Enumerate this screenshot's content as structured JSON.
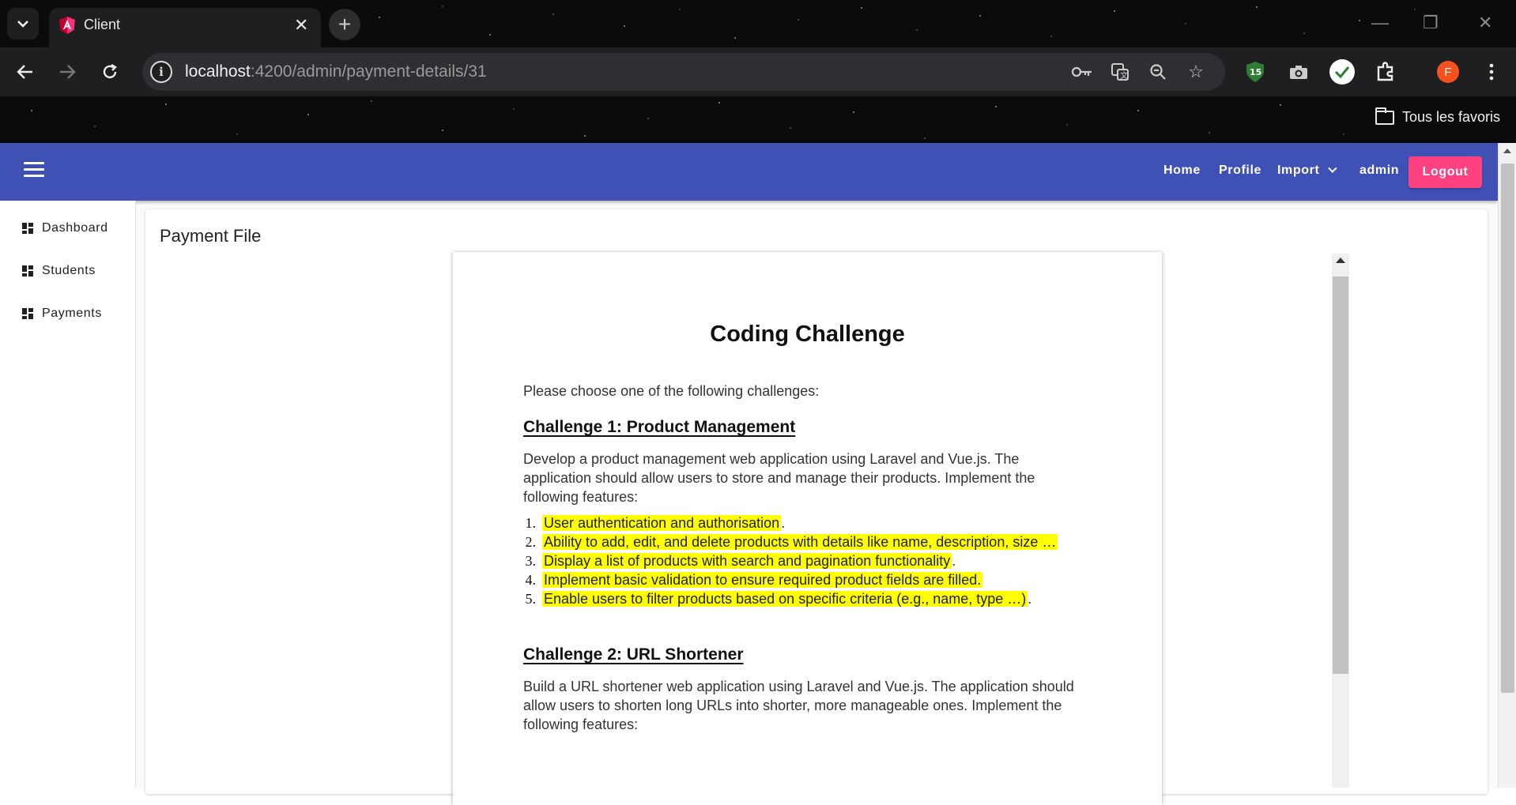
{
  "browser": {
    "tab_title": "Client",
    "url_host": "localhost",
    "url_path": ":4200/admin/payment-details/31",
    "bookmarks_label": "Tous les favoris",
    "profile_initial": "F",
    "extension_badge": "15"
  },
  "appbar": {
    "nav": {
      "home": "Home",
      "profile": "Profile",
      "import": "Import",
      "user": "admin",
      "logout": "Logout"
    },
    "color": "#3f51b5",
    "logout_color": "#ff4081"
  },
  "sidebar": {
    "items": [
      {
        "label": "Dashboard"
      },
      {
        "label": "Students"
      },
      {
        "label": "Payments"
      }
    ]
  },
  "main": {
    "title": "Payment File"
  },
  "document": {
    "title": "Coding Challenge",
    "intro": "Please choose one of the following challenges:",
    "challenge1": {
      "heading": "Challenge 1: Product Management",
      "desc_lines": [
        "Develop a product management web application using Laravel and Vue.js. The",
        "application should allow users to store and manage their products. Implement the",
        "following features:"
      ],
      "features": [
        {
          "num": "1.",
          "text": "User authentication and authorisation",
          "after": "."
        },
        {
          "num": "2.",
          "text": "Ability to add, edit, and delete products with details like name, description, size …",
          "after": ""
        },
        {
          "num": "3.",
          "text": "Display a list of products with search and pagination functionality",
          "after": "."
        },
        {
          "num": "4.",
          "text": "Implement basic validation to ensure required product fields are filled.",
          "after": ""
        },
        {
          "num": "5.",
          "text": "Enable users to filter products based on specific criteria (e.g., name, type …)",
          "after": "."
        }
      ]
    },
    "challenge2": {
      "heading": "Challenge 2: URL Shortener",
      "desc_lines": [
        "Build a URL shortener web application using Laravel and Vue.js. The application should",
        "allow users to shorten long URLs into shorter, more manageable ones. Implement the",
        "following features:"
      ]
    },
    "highlight_color": "#ffff00"
  }
}
